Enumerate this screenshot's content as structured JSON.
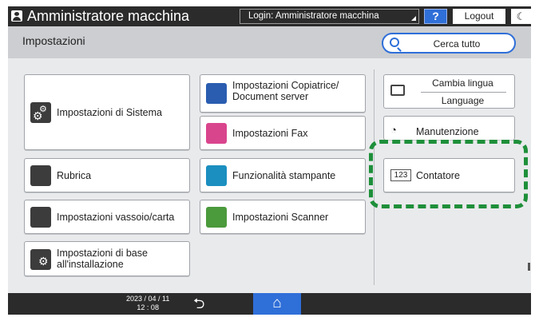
{
  "header": {
    "title": "Amministratore macchina",
    "login_text": "Login: Amministratore macchina",
    "help_label": "?",
    "logout_label": "Logout",
    "moon_glyph": "☾",
    "icons": {
      "user": "user-icon",
      "moon": "moon-icon"
    }
  },
  "subheader": {
    "page_title": "Impostazioni",
    "search_label": "Cerca tutto"
  },
  "tiles": {
    "system": "Impostazioni di Sistema",
    "copier": "Impostazioni Copiatrice/ Document server",
    "fax": "Impostazioni Fax",
    "printer": "Funzionalità stampante",
    "addressbook": "Rubrica",
    "tray": "Impostazioni vassoio/carta",
    "scanner": "Impostazioni Scanner",
    "install": "Impostazioni di base all'installazione"
  },
  "right_panel": {
    "lang_primary": "Cambia lingua",
    "lang_secondary": "Language",
    "maintenance": "Manutenzione",
    "counter_badge": "123",
    "counter": "Contatore"
  },
  "footer": {
    "date": "2023 / 04 / 11",
    "time": "12 : 08",
    "back_glyph": "⮌",
    "home_glyph": "⌂"
  },
  "colors": {
    "accent": "#2f6fd8",
    "highlight": "#1e8f3a",
    "bar": "#2b2b2b"
  }
}
